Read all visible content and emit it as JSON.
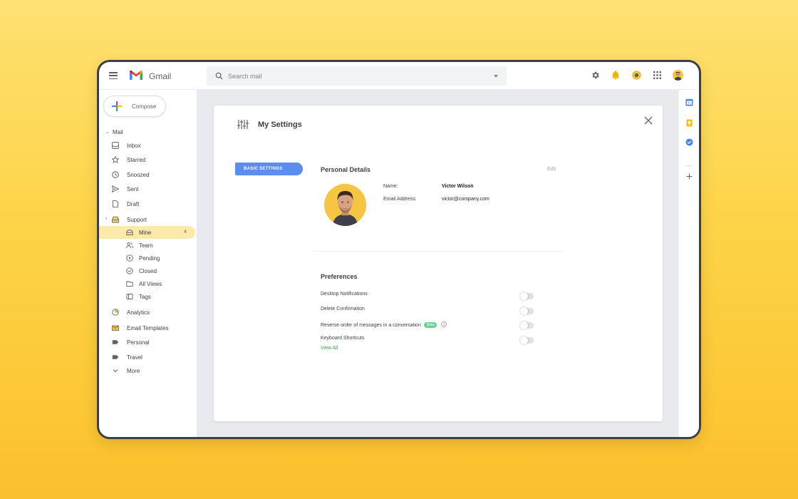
{
  "app": {
    "name": "Gmail"
  },
  "search": {
    "placeholder": "Search mail"
  },
  "sidebar": {
    "compose_label": "Compose",
    "mail_section": "Mail",
    "mail_items": [
      {
        "label": "Inbox",
        "icon": "inbox-icon"
      },
      {
        "label": "Starred",
        "icon": "star-icon"
      },
      {
        "label": "Snoozed",
        "icon": "clock-icon"
      },
      {
        "label": "Sent",
        "icon": "send-icon"
      },
      {
        "label": "Draft",
        "icon": "draft-icon"
      }
    ],
    "support_section": "Support",
    "support_items": [
      {
        "label": "Mine",
        "count": "4",
        "active": true
      },
      {
        "label": "Team"
      },
      {
        "label": "Pending"
      },
      {
        "label": "Closed"
      },
      {
        "label": "All Views"
      },
      {
        "label": "Tags"
      }
    ],
    "other_items": [
      {
        "label": "Analytics"
      },
      {
        "label": "Email Templates"
      },
      {
        "label": "Personal"
      },
      {
        "label": "Travel"
      },
      {
        "label": "More"
      }
    ]
  },
  "settings": {
    "title": "My Settings",
    "tab_label": "BASIC SETTINGS",
    "personal": {
      "title": "Personal Details",
      "edit_label": "Edit",
      "name_label": "Name:",
      "name_value": "Victor Wilson",
      "email_label": "Email Address:",
      "email_value": "victor@company.com"
    },
    "preferences": {
      "title": "Preferences",
      "items": [
        {
          "label": "Desktop Notifications",
          "enabled": false
        },
        {
          "label": "Delete Confirmation",
          "enabled": false
        },
        {
          "label": "Reverse order of messages in a conversation",
          "badge": "Beta",
          "enabled": false
        },
        {
          "label": "Keyboard Shortcuts",
          "enabled": false
        }
      ],
      "view_all_label": "View All"
    }
  },
  "colors": {
    "accent_blue": "#5b8def",
    "active_nav_bg": "#fde9a9",
    "beta_green": "#6fcf97",
    "background_yellow": "#fdd447"
  }
}
